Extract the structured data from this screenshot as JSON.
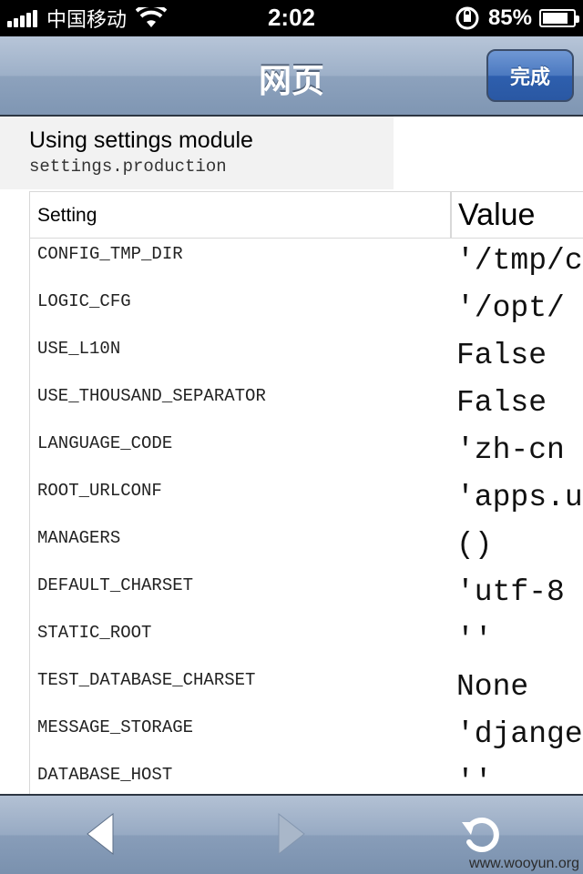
{
  "status_bar": {
    "carrier": "中国移动",
    "time": "2:02",
    "battery_percent": "85%",
    "battery_level": 0.85,
    "icons": [
      "signal-icon",
      "wifi-icon",
      "rotation-lock-icon",
      "battery-icon"
    ]
  },
  "nav_bar": {
    "title": "网页",
    "done_label": "完成"
  },
  "module": {
    "title": "Using settings module",
    "name": "settings.production"
  },
  "table": {
    "headers": {
      "setting": "Setting",
      "value": "Value"
    },
    "rows": [
      {
        "key": "CONFIG_TMP_DIR",
        "value": "'/tmp/c"
      },
      {
        "key": "LOGIC_CFG",
        "value": "'/opt/"
      },
      {
        "key": "USE_L10N",
        "value": "False"
      },
      {
        "key": "USE_THOUSAND_SEPARATOR",
        "value": "False"
      },
      {
        "key": "LANGUAGE_CODE",
        "value": "'zh-cn"
      },
      {
        "key": "ROOT_URLCONF",
        "value": "'apps.u"
      },
      {
        "key": "MANAGERS",
        "value": "()"
      },
      {
        "key": "DEFAULT_CHARSET",
        "value": "'utf-8"
      },
      {
        "key": "STATIC_ROOT",
        "value": "''"
      },
      {
        "key": "TEST_DATABASE_CHARSET",
        "value": "None"
      },
      {
        "key": "MESSAGE_STORAGE",
        "value": "'djange"
      },
      {
        "key": "DATABASE_HOST",
        "value": "''"
      }
    ]
  },
  "toolbar": {
    "icons": [
      "back-arrow-icon",
      "forward-arrow-icon",
      "reload-icon"
    ],
    "watermark": "www.wooyun.org"
  },
  "colors": {
    "nav_bar": "#9db0c8",
    "done_button": "#3d6cb8",
    "status_bar": "#000000"
  }
}
